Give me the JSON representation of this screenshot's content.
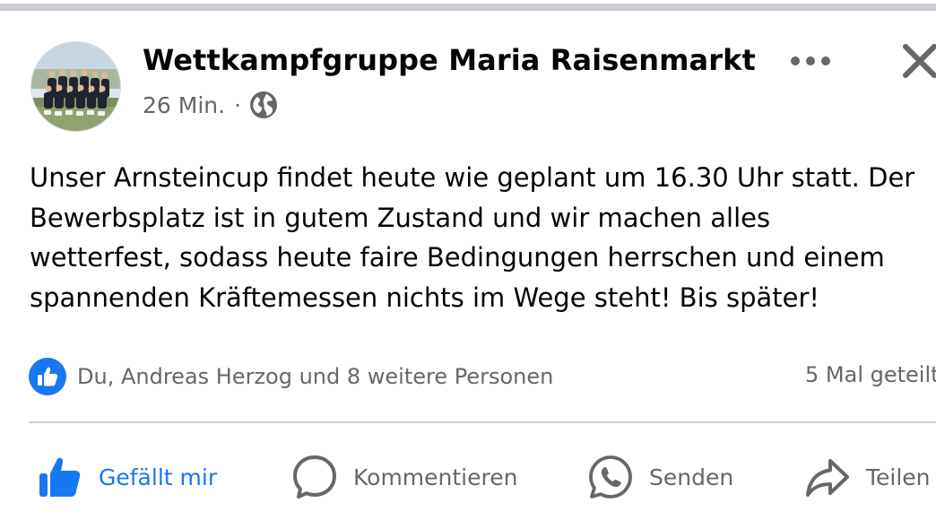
{
  "post": {
    "page_name": "Wettkampfgruppe Maria Raisenmarkt",
    "time": "26 Min.",
    "separator": "·",
    "privacy_icon": "globe-icon",
    "body_lines": [
      "Unser Arnsteincup findet heute wie geplant um 16.30 Uhr statt. Der",
      "Bewerbsplatz ist in gutem Zustand und wir machen alles",
      "wetterfest, sodass heute faire Bedingungen herrschen und einem",
      "spannenden Kräftemessen nichts im Wege steht! Bis später!"
    ],
    "reactions_text": "Du, Andreas Herzog und 8 weitere Personen",
    "shares_text": "5 Mal geteilt"
  },
  "actions": {
    "like": "Gefällt mir",
    "comment": "Kommentieren",
    "send": "Senden",
    "share": "Teilen"
  },
  "colors": {
    "accent": "#1877f2",
    "secondary_text": "#65676b",
    "divider": "#ced0d4"
  }
}
